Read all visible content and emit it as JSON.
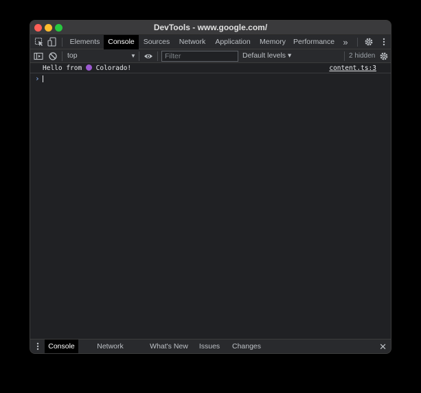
{
  "window": {
    "title": "DevTools - www.google.com/"
  },
  "tabs": {
    "items": [
      {
        "label": "Elements"
      },
      {
        "label": "Console"
      },
      {
        "label": "Sources"
      },
      {
        "label": "Network"
      },
      {
        "label": "Application"
      },
      {
        "label": "Memory"
      },
      {
        "label": "Performance"
      }
    ],
    "more_label": "»",
    "active": "Console"
  },
  "toolbar": {
    "context": "top",
    "filter_placeholder": "Filter",
    "levels_label": "Default levels ▾",
    "hidden_count": "2 hidden"
  },
  "console": {
    "messages": [
      {
        "text_before": "Hello from ",
        "text_after": " Colorado!",
        "source": "content.ts:3"
      }
    ],
    "prompt": "›"
  },
  "drawer": {
    "tabs": [
      {
        "label": "Console"
      },
      {
        "label": "Network conditions"
      },
      {
        "label": "What's New"
      },
      {
        "label": "Issues"
      },
      {
        "label": "Changes"
      }
    ],
    "active": "Console",
    "close_glyph": "✕"
  },
  "colors": {
    "accent": "#8ab4f8",
    "emoji_purple": "#9b59d0"
  }
}
